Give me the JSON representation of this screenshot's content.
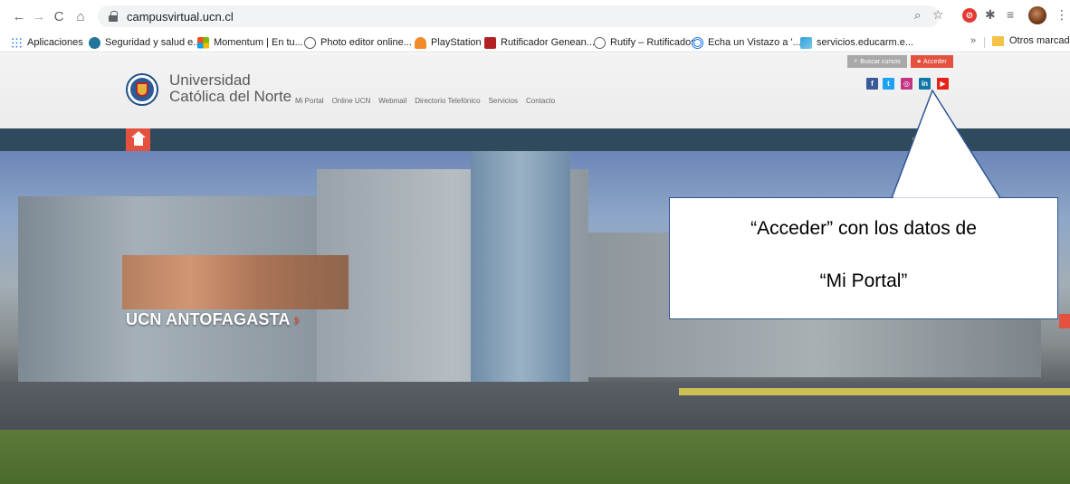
{
  "browser": {
    "url": "campusvirtual.ucn.cl",
    "bookmarks": [
      {
        "label": "Aplicaciones",
        "icon": "apps-grid-icon",
        "color": "#1a73e8"
      },
      {
        "label": "Seguridad y salud e...",
        "icon": "wordpress-icon",
        "color": "#21759b"
      },
      {
        "label": "Momentum | En tu...",
        "icon": "windows-logo-icon",
        "color": "#f25022"
      },
      {
        "label": "Photo editor online...",
        "icon": "photo-editor-icon",
        "color": "#555555"
      },
      {
        "label": "PlayStation",
        "icon": "playstation-icon",
        "color": "#f28c28"
      },
      {
        "label": "Rutificador Genean...",
        "icon": "rutificador-icon",
        "color": "#b22222"
      },
      {
        "label": "Rutify – Rutificador",
        "icon": "globe-icon",
        "color": "#5f6368"
      },
      {
        "label": "Echa un Vistazo a '...",
        "icon": "target-icon",
        "color": "#1a73e8"
      },
      {
        "label": "servicios.educarm.e...",
        "icon": "educarm-icon",
        "color": "#2fa0d8"
      }
    ],
    "bookmarks_more": "»",
    "other_bookmarks": "Otros marcadores"
  },
  "site": {
    "university_line1": "Universidad",
    "university_line2": "Católica del Norte",
    "nav": [
      "Mi Portal",
      "Online UCN",
      "Webmail",
      "Directorio Telefónico",
      "Servicios",
      "Contacto"
    ],
    "search_courses": "Buscar cursos",
    "login": "Acceder",
    "social": {
      "facebook": "f",
      "twitter": "t",
      "instagram": "◎",
      "linkedin": "in",
      "youtube": "▶"
    },
    "accent_color": "#e4513f",
    "nav_strip_color": "#2f4a5c"
  },
  "hero": {
    "caption": "UCN ANTOFAGASTA",
    "caption_arrow": "›"
  },
  "annotation": {
    "line1": "“Acceder” con los datos de",
    "line2": "“Mi Portal”"
  }
}
